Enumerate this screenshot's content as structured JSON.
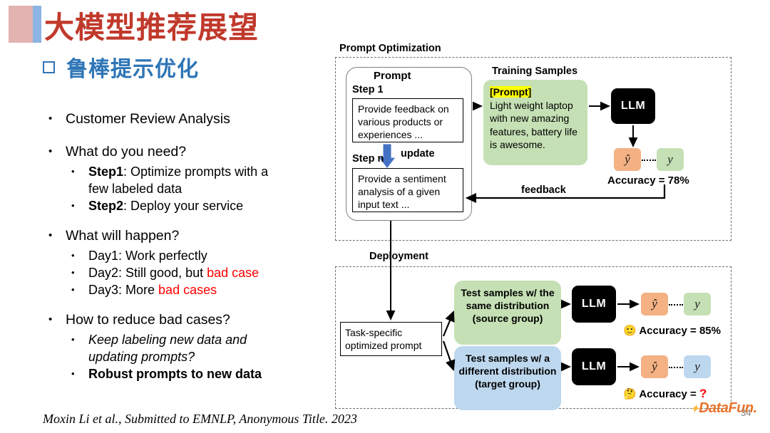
{
  "slide": {
    "title": "大模型推荐展望",
    "subtitle": "鲁棒提示优化",
    "citation": "Moxin Li et al., Submitted to EMNLP, Anonymous Title. 2023",
    "page_number": "34",
    "brand": "DataFun.",
    "accent_pink": "#e3b3b2",
    "accent_blue": "#8cb4e4",
    "title_color": "#c0392b",
    "subtitle_color": "#2e75b6"
  },
  "bullets": {
    "l1_customer": "Customer Review Analysis",
    "l1_need": "What do you need?",
    "need_step1_label": "Step1",
    "need_step1_rest": ": Optimize prompts with a",
    "need_step1_cont": "few labeled data",
    "need_step2_label": "Step2",
    "need_step2_rest": ": Deploy your service",
    "l1_happen": "What will happen?",
    "day1": "Day1: Work perfectly",
    "day2_pre": "Day2: Still good, but ",
    "day2_red": "bad case",
    "day3_pre": "Day3: More ",
    "day3_red": "bad cases",
    "l1_reduce": "How to reduce bad cases?",
    "reduce_a": "Keep labeling new data and",
    "reduce_a_cont": "updating prompts?",
    "reduce_b": "Robust prompts to new data"
  },
  "diagram": {
    "prompt_optimization_label": "Prompt Optimization",
    "deployment_label": "Deployment",
    "prompt_heading": "Prompt",
    "step1_label": "Step 1",
    "step1_text": "Provide feedback on various products or experiences ...",
    "stepn_label": "Step n",
    "stepn_text": "Provide a sentiment analysis of a given input text ...",
    "update_label": "update",
    "update_arrow_color": "#4472c4",
    "training_samples_label": "Training Samples",
    "training_prompt_tag": "[Prompt]",
    "training_sample_text": "Light weight laptop with new amazing features, battery life is awesome.",
    "llm_label": "LLM",
    "yhat": "ŷ",
    "y": "y",
    "accuracy_train": "Accuracy = 78%",
    "feedback_label": "feedback",
    "task_prompt_text": "Task-specific optimized prompt",
    "test_source": "Test samples w/ the same distribution (source group)",
    "test_target": "Test samples w/ a different distribution (target group)",
    "accuracy_source_emoji": "🙂",
    "accuracy_source": "Accuracy = 85%",
    "accuracy_target_emoji": "🤔",
    "accuracy_target_prefix": "Accuracy = ",
    "accuracy_target_value": "?",
    "colors": {
      "green": "#c5e0b4",
      "blue": "#bdd7ee",
      "orange": "#f4b183",
      "highlight": "#ffff00",
      "black": "#000000"
    }
  }
}
